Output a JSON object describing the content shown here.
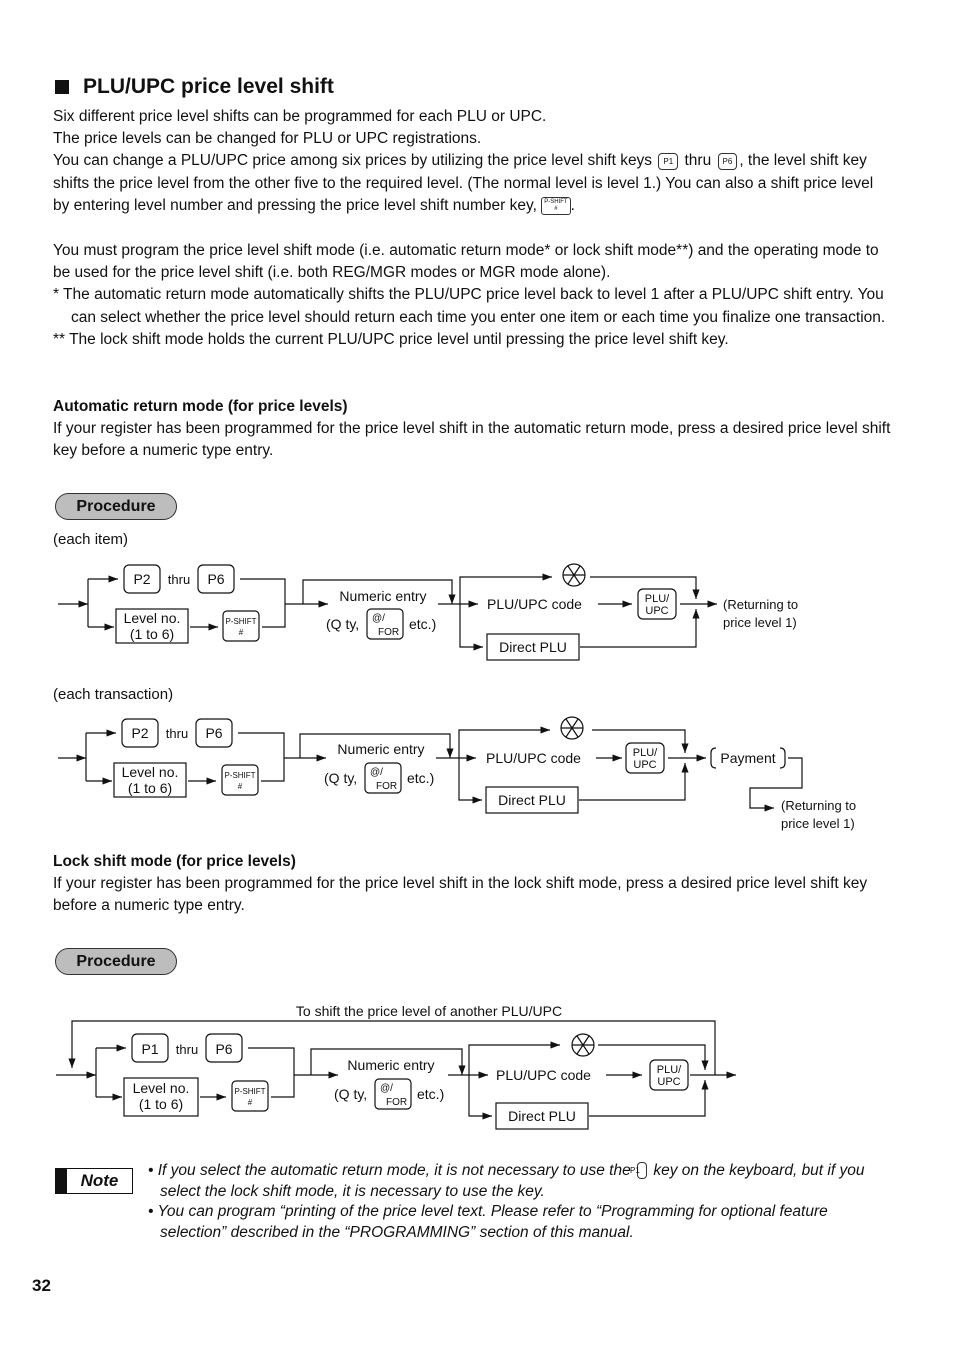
{
  "title": "PLU/UPC price level shift",
  "intro": {
    "line1": "Six different price level shifts can be programmed for each PLU or UPC.",
    "line2": "The price levels can be changed for PLU or UPC registrations.",
    "line3a": "You can change a PLU/UPC price among six prices by utilizing the price level shift keys",
    "key_p1": "P1",
    "thru": "thru",
    "key_p6": "P6",
    "line3b": ", the level shift key shifts the price level from the other five to the required level.  (The normal level is level 1.)  You can also a shift price level by entering level number and pressing the price level shift number key,",
    "pshift_top": "P-SHIFT",
    "pshift_bottom": "#",
    "period": "."
  },
  "program": {
    "para": "You must program the price level shift mode (i.e. automatic return mode* or lock shift mode**) and the operating mode to be used for the price level shift (i.e. both REG/MGR modes or MGR mode alone).",
    "note1": "*   The automatic return mode automatically shifts the PLU/UPC price level back to level 1 after a PLU/UPC shift entry. You can select whether the price level should return each time you enter one item or each time you finalize one transaction.",
    "note2": "** The lock shift mode holds the current PLU/UPC price level until pressing the price level shift key."
  },
  "auto": {
    "heading": "Automatic return mode (for price levels)",
    "text": "If your register has been programmed for the price level shift in the automatic return mode, press a desired price level shift key before a numeric type entry."
  },
  "lock": {
    "heading": "Lock shift mode (for price levels)",
    "text": "If your register has been programmed for the price level shift in the lock shift mode, press a desired price level shift key before a numeric type entry."
  },
  "procedure_label": "Procedure",
  "diagram": {
    "each_item": "(each item)",
    "each_transaction": "(each transaction)",
    "p2": "P2",
    "p1": "P1",
    "p6": "P6",
    "thru": "thru",
    "level_no": "Level no.",
    "level_range": "(1 to 6)",
    "pshift": "P-SHIFT",
    "hash": "#",
    "numeric_entry": "Numeric entry",
    "qty": "(Q ty,",
    "at": "@/",
    "for": "FOR",
    "etc": "etc.)",
    "plu_upc_code": "PLU/UPC code",
    "plu_key_top": "PLU/",
    "plu_key_bottom": "UPC",
    "direct_plu": "Direct PLU",
    "returning1": "(Returning to",
    "returning2": "price level 1)",
    "payment": "Payment",
    "another": "To shift the price level of another PLU/UPC"
  },
  "note": {
    "label": "Note",
    "b1a": "• If you select the automatic return mode, it is not necessary to use the",
    "b1key": "P1",
    "b1b": "key on the keyboard, but if you select the lock shift mode, it is necessary to use the key.",
    "b2": "• You can program “printing of the price level text. Please refer to “Programming for optional feature selection” described in the “PROGRAMMING” section of this manual."
  },
  "page_number": "32"
}
